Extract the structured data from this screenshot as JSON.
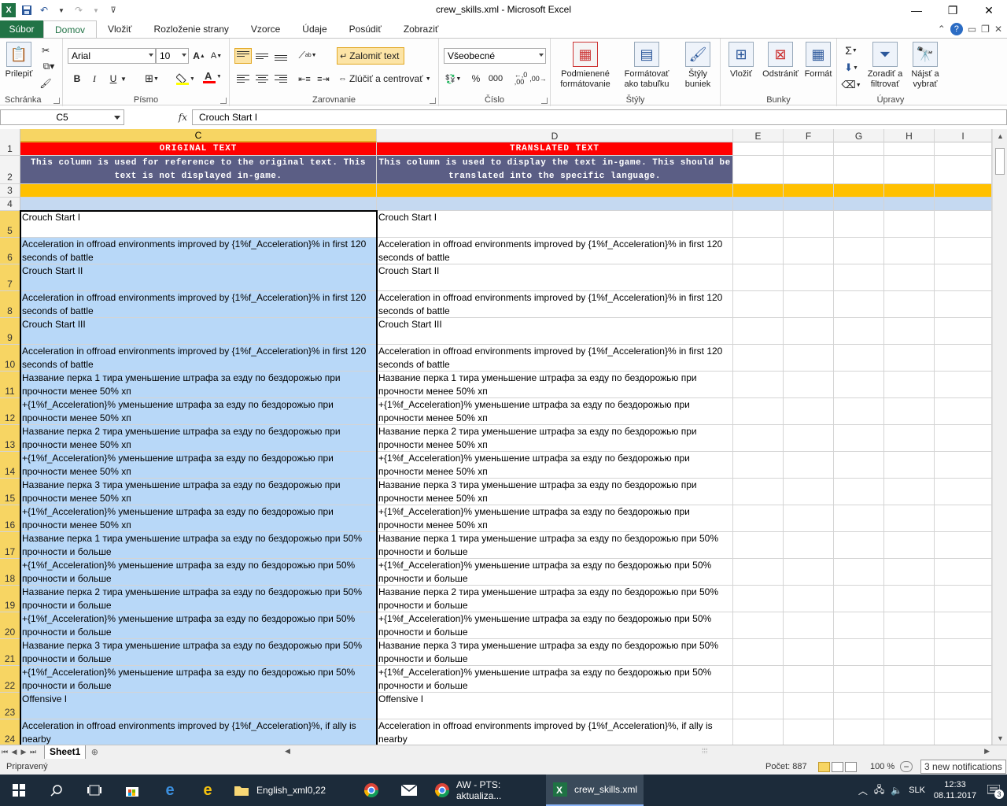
{
  "window": {
    "title": "crew_skills.xml  -  Microsoft Excel"
  },
  "qat": {
    "icons": [
      "excel-logo",
      "save-icon",
      "undo-icon",
      "redo-icon",
      "customize-icon"
    ]
  },
  "tabs": [
    "Súbor",
    "Domov",
    "Vložiť",
    "Rozloženie strany",
    "Vzorce",
    "Údaje",
    "Posúdiť",
    "Zobraziť"
  ],
  "ribbon": {
    "clipboard": {
      "paste": "Prilepiť",
      "label": "Schránka"
    },
    "font": {
      "name": "Arial",
      "size": "10",
      "bold": "B",
      "italic": "I",
      "underline": "U",
      "label": "Písmo"
    },
    "alignment": {
      "wrap": "Zalomiť text",
      "merge": "Zlúčiť a centrovať",
      "label": "Zarovnanie"
    },
    "number": {
      "format": "Všeobecné",
      "label": "Číslo"
    },
    "styles": {
      "conditional": "Podmienené formátovanie",
      "table": "Formátovať ako tabuľku",
      "cell": "Štýly buniek",
      "label": "Štýly"
    },
    "cells": {
      "insert": "Vložiť",
      "delete": "Odstrániť",
      "format": "Formát",
      "label": "Bunky"
    },
    "editing": {
      "sort": "Zoradiť a filtrovať",
      "find": "Nájsť a vybrať",
      "label": "Úpravy"
    }
  },
  "formula_bar": {
    "name_box": "C5",
    "fx": "fx",
    "value": "Crouch Start I"
  },
  "columns": [
    {
      "label": "C",
      "selected": true
    },
    {
      "label": "D",
      "selected": false
    },
    {
      "label": "E",
      "selected": false
    },
    {
      "label": "F",
      "selected": false
    },
    {
      "label": "G",
      "selected": false
    },
    {
      "label": "H",
      "selected": false
    },
    {
      "label": "I",
      "selected": false
    }
  ],
  "header_row": {
    "c": "ORIGINAL TEXT",
    "d": "TRANSLATED TEXT"
  },
  "desc_row": {
    "c": "This column is used for reference to the original text. This text is not displayed in-game.",
    "d": "This column is used to display the text in-game. This should be translated into the specific language."
  },
  "rows": [
    {
      "n": "5",
      "c": "Crouch Start I",
      "d": "Crouch Start I"
    },
    {
      "n": "6",
      "c": "Acceleration in offroad environments improved by {1%f_Acceleration}% in first 120 seconds of battle",
      "d": "Acceleration in offroad environments improved by {1%f_Acceleration}% in first 120 seconds of battle"
    },
    {
      "n": "7",
      "c": "Crouch Start II",
      "d": "Crouch Start II"
    },
    {
      "n": "8",
      "c": "Acceleration in offroad environments improved by {1%f_Acceleration}% in first 120 seconds of battle",
      "d": "Acceleration in offroad environments improved by {1%f_Acceleration}% in first 120 seconds of battle"
    },
    {
      "n": "9",
      "c": "Crouch Start III",
      "d": "Crouch Start III"
    },
    {
      "n": "10",
      "c": "Acceleration in offroad environments improved by {1%f_Acceleration}% in first 120 seconds of battle",
      "d": "Acceleration in offroad environments improved by {1%f_Acceleration}% in first 120 seconds of battle"
    },
    {
      "n": "11",
      "c": "Название перка 1 тира уменьшение штрафа за езду по бездорожью при прочности менее 50% хп",
      "d": "Название перка 1 тира уменьшение штрафа за езду по бездорожью при прочности менее 50% хп"
    },
    {
      "n": "12",
      "c": "+{1%f_Acceleration}% уменьшение штрафа за езду по бездорожью при прочности менее 50% хп",
      "d": "+{1%f_Acceleration}% уменьшение штрафа за езду по бездорожью при прочности менее 50% хп"
    },
    {
      "n": "13",
      "c": "Название перка 2 тира уменьшение штрафа за езду по бездорожью при прочности менее 50% хп",
      "d": "Название перка 2 тира уменьшение штрафа за езду по бездорожью при прочности менее 50% хп"
    },
    {
      "n": "14",
      "c": "+{1%f_Acceleration}% уменьшение штрафа за езду по бездорожью при прочности менее 50% хп",
      "d": "+{1%f_Acceleration}% уменьшение штрафа за езду по бездорожью при прочности менее 50% хп"
    },
    {
      "n": "15",
      "c": "Название перка 3 тира уменьшение штрафа за езду по бездорожью при прочности менее 50% хп",
      "d": "Название перка 3 тира уменьшение штрафа за езду по бездорожью при прочности менее 50% хп"
    },
    {
      "n": "16",
      "c": "+{1%f_Acceleration}% уменьшение штрафа за езду по бездорожью при прочности менее 50% хп",
      "d": "+{1%f_Acceleration}% уменьшение штрафа за езду по бездорожью при прочности менее 50% хп"
    },
    {
      "n": "17",
      "c": "Название перка 1 тира уменьшение штрафа за езду по бездорожью при 50% прочности и больше",
      "d": "Название перка 1 тира уменьшение штрафа за езду по бездорожью при 50% прочности и больше"
    },
    {
      "n": "18",
      "c": "+{1%f_Acceleration}% уменьшение штрафа за езду по бездорожью при 50% прочности и больше",
      "d": "+{1%f_Acceleration}% уменьшение штрафа за езду по бездорожью при 50% прочности и больше"
    },
    {
      "n": "19",
      "c": "Название перка 2 тира уменьшение штрафа за езду по бездорожью при 50% прочности и больше",
      "d": "Название перка 2 тира уменьшение штрафа за езду по бездорожью при 50% прочности и больше"
    },
    {
      "n": "20",
      "c": "+{1%f_Acceleration}% уменьшение штрафа за езду по бездорожью при 50% прочности и больше",
      "d": "+{1%f_Acceleration}% уменьшение штрафа за езду по бездорожью при 50% прочности и больше"
    },
    {
      "n": "21",
      "c": "Название перка 3 тира уменьшение штрафа за езду по бездорожью при 50% прочности и больше",
      "d": "Название перка 3 тира уменьшение штрафа за езду по бездорожью при 50% прочности и больше"
    },
    {
      "n": "22",
      "c": "+{1%f_Acceleration}% уменьшение штрафа за езду по бездорожью при 50% прочности и больше",
      "d": "+{1%f_Acceleration}% уменьшение штрафа за езду по бездорожью при 50% прочности и больше"
    },
    {
      "n": "23",
      "c": "Offensive I",
      "d": "Offensive I"
    },
    {
      "n": "24",
      "c": "Acceleration in offroad environments improved by {1%f_Acceleration}%, if ally is nearby",
      "d": "Acceleration in offroad environments improved by {1%f_Acceleration}%, if ally is nearby"
    }
  ],
  "sheet": {
    "name": "Sheet1"
  },
  "status": {
    "ready": "Pripravený",
    "count": "Počet: 887",
    "zoom": "100 %",
    "notification": "3 new notifications"
  },
  "taskbar": {
    "apps": [
      {
        "label": "English_xml0,22",
        "icon": "folder-icon"
      },
      {
        "label": "",
        "icon": "chrome-icon"
      },
      {
        "label": "",
        "icon": "mail-icon"
      },
      {
        "label": "AW - PTS: aktualiza...",
        "icon": "chrome-icon"
      },
      {
        "label": "crew_skills.xml",
        "icon": "excel-icon"
      }
    ],
    "lang": "SLK",
    "time": "12:33",
    "date": "08.11.2017",
    "notif_count": "3"
  },
  "colors": {
    "excel_green": "#217346",
    "header_red": "#ff0000",
    "desc_purple": "#5b5e85",
    "band_yellow": "#ffc000",
    "selection_blue": "#b8d8f8",
    "taskbar": "#1c2b3a"
  }
}
